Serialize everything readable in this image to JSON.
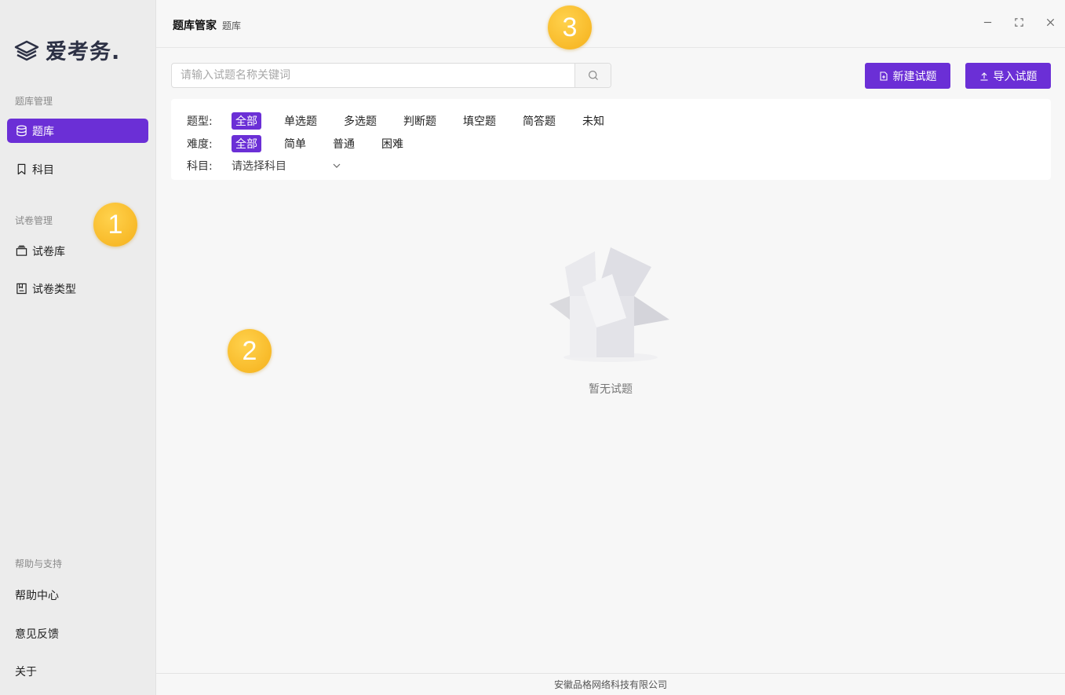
{
  "brand": {
    "name": "爱考务."
  },
  "sidebar": {
    "section_question": "题库管理",
    "item_bank": "题库",
    "item_subject": "科目",
    "section_paper": "试卷管理",
    "item_paper_bank": "试卷库",
    "item_paper_type": "试卷类型",
    "section_help": "帮助与支持",
    "help_center": "帮助中心",
    "feedback": "意见反馈",
    "about": "关于"
  },
  "titlebar": {
    "app_title": "题库管家",
    "page": "题库"
  },
  "search": {
    "placeholder": "请输入试题名称关键词"
  },
  "buttons": {
    "new_question": "新建试题",
    "import_question": "导入试题"
  },
  "filters": {
    "type_label": "题型:",
    "types": [
      "全部",
      "单选题",
      "多选题",
      "判断题",
      "填空题",
      "简答题",
      "未知"
    ],
    "difficulty_label": "难度:",
    "difficulties": [
      "全部",
      "简单",
      "普通",
      "困难"
    ],
    "subject_label": "科目:",
    "subject_placeholder": "请选择科目"
  },
  "empty": {
    "text": "暂无试题"
  },
  "footer": {
    "company": "安徽品格网络科技有限公司"
  },
  "badges": [
    "1",
    "2",
    "3"
  ],
  "colors": {
    "accent": "#6b2fd6",
    "badge": "#f5b01a"
  }
}
